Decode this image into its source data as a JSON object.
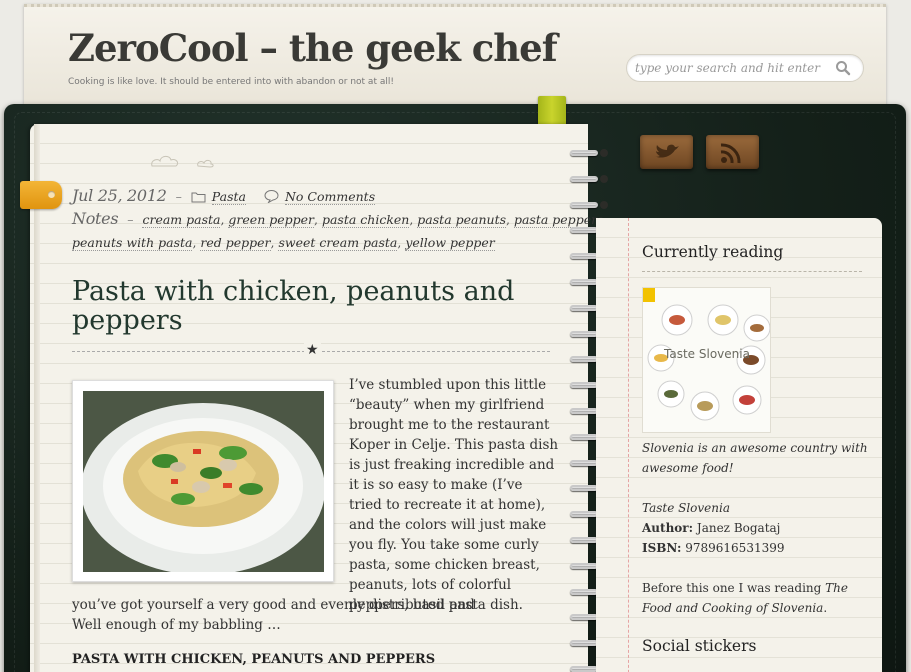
{
  "header": {
    "title": "ZeroCool – the geek chef",
    "tagline": "Cooking is like love. It should be entered into with abandon or not at all!",
    "search_placeholder": "type your search and hit enter"
  },
  "post": {
    "date": "Jul 25, 2012",
    "category": "Pasta",
    "comments": "No Comments",
    "notes_label": "Notes",
    "tags": [
      "cream pasta",
      "green pepper",
      "pasta chicken",
      "pasta peanuts",
      "pasta peppers",
      "peanuts with pasta",
      "red pepper",
      "sweet cream pasta",
      "yellow pepper"
    ],
    "title": "Pasta with chicken, peanuts and peppers",
    "intro_right": "I’ve stumbled upon this little “beauty” when my girlfriend brought me to the restaurant Koper in Celje. This pasta dish is just freaking incredible and it is so easy to make (I’ve tried to recreate it at home), and the colors will just make you fly. You take some curly pasta, some chicken breast, peanuts, lots of colorful peppers, basil and",
    "intro_full": "you’ve got yourself a very good and evenly distributed pasta dish. Well enough of my babbling …",
    "recipe_heading": "PASTA WITH CHICKEN, PEANUTS AND PEPPERS"
  },
  "sidebar": {
    "reading_title": "Currently reading",
    "book_cover_title": "Taste Slovenia",
    "book_caption": "Slovenia is an awesome country with awesome food!",
    "book_title": "Taste Slovenia",
    "author_label": "Author:",
    "author": "Janez Bogataj",
    "isbn_label": "ISBN:",
    "isbn": "9789616531399",
    "before_prefix": "Before this one I was reading",
    "before_book": "The Food and Cooking of Slovenia",
    "before_suffix": ".",
    "social_title": "Social stickers"
  },
  "icons": {
    "search": "search-icon",
    "folder": "folder-icon",
    "comment": "comment-bubble-icon",
    "twitter": "twitter-bird-icon",
    "rss": "rss-feed-icon"
  },
  "colors": {
    "binder": "#142019",
    "paper": "#f4f2ea",
    "title": "#22382e",
    "date_tab": "#f0a62a",
    "bookmark": "#c9d42c",
    "social_wood": "#8a5c30"
  }
}
